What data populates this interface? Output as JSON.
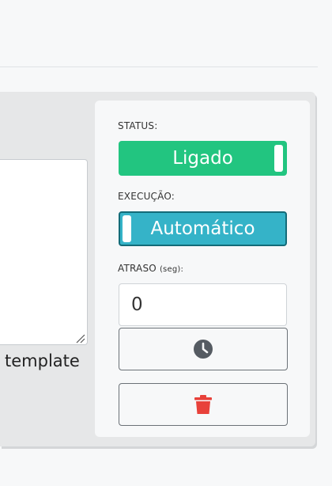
{
  "editor": {
    "trailing_text": "template"
  },
  "panel": {
    "status_label": "STATUS:",
    "status_toggle_text": "Ligado",
    "exec_label": "EXECUÇÃO:",
    "exec_toggle_text": "Automático",
    "delay_label_main": "ATRASO",
    "delay_label_unit": "(seg):",
    "delay_value": "0"
  },
  "colors": {
    "status_on": "#22c580",
    "exec_auto": "#35b3c8",
    "delete_icon": "#e8413a",
    "clock_icon": "#555b62"
  },
  "icons": {
    "clock_button": "clock-icon",
    "delete_button": "trash-icon"
  }
}
